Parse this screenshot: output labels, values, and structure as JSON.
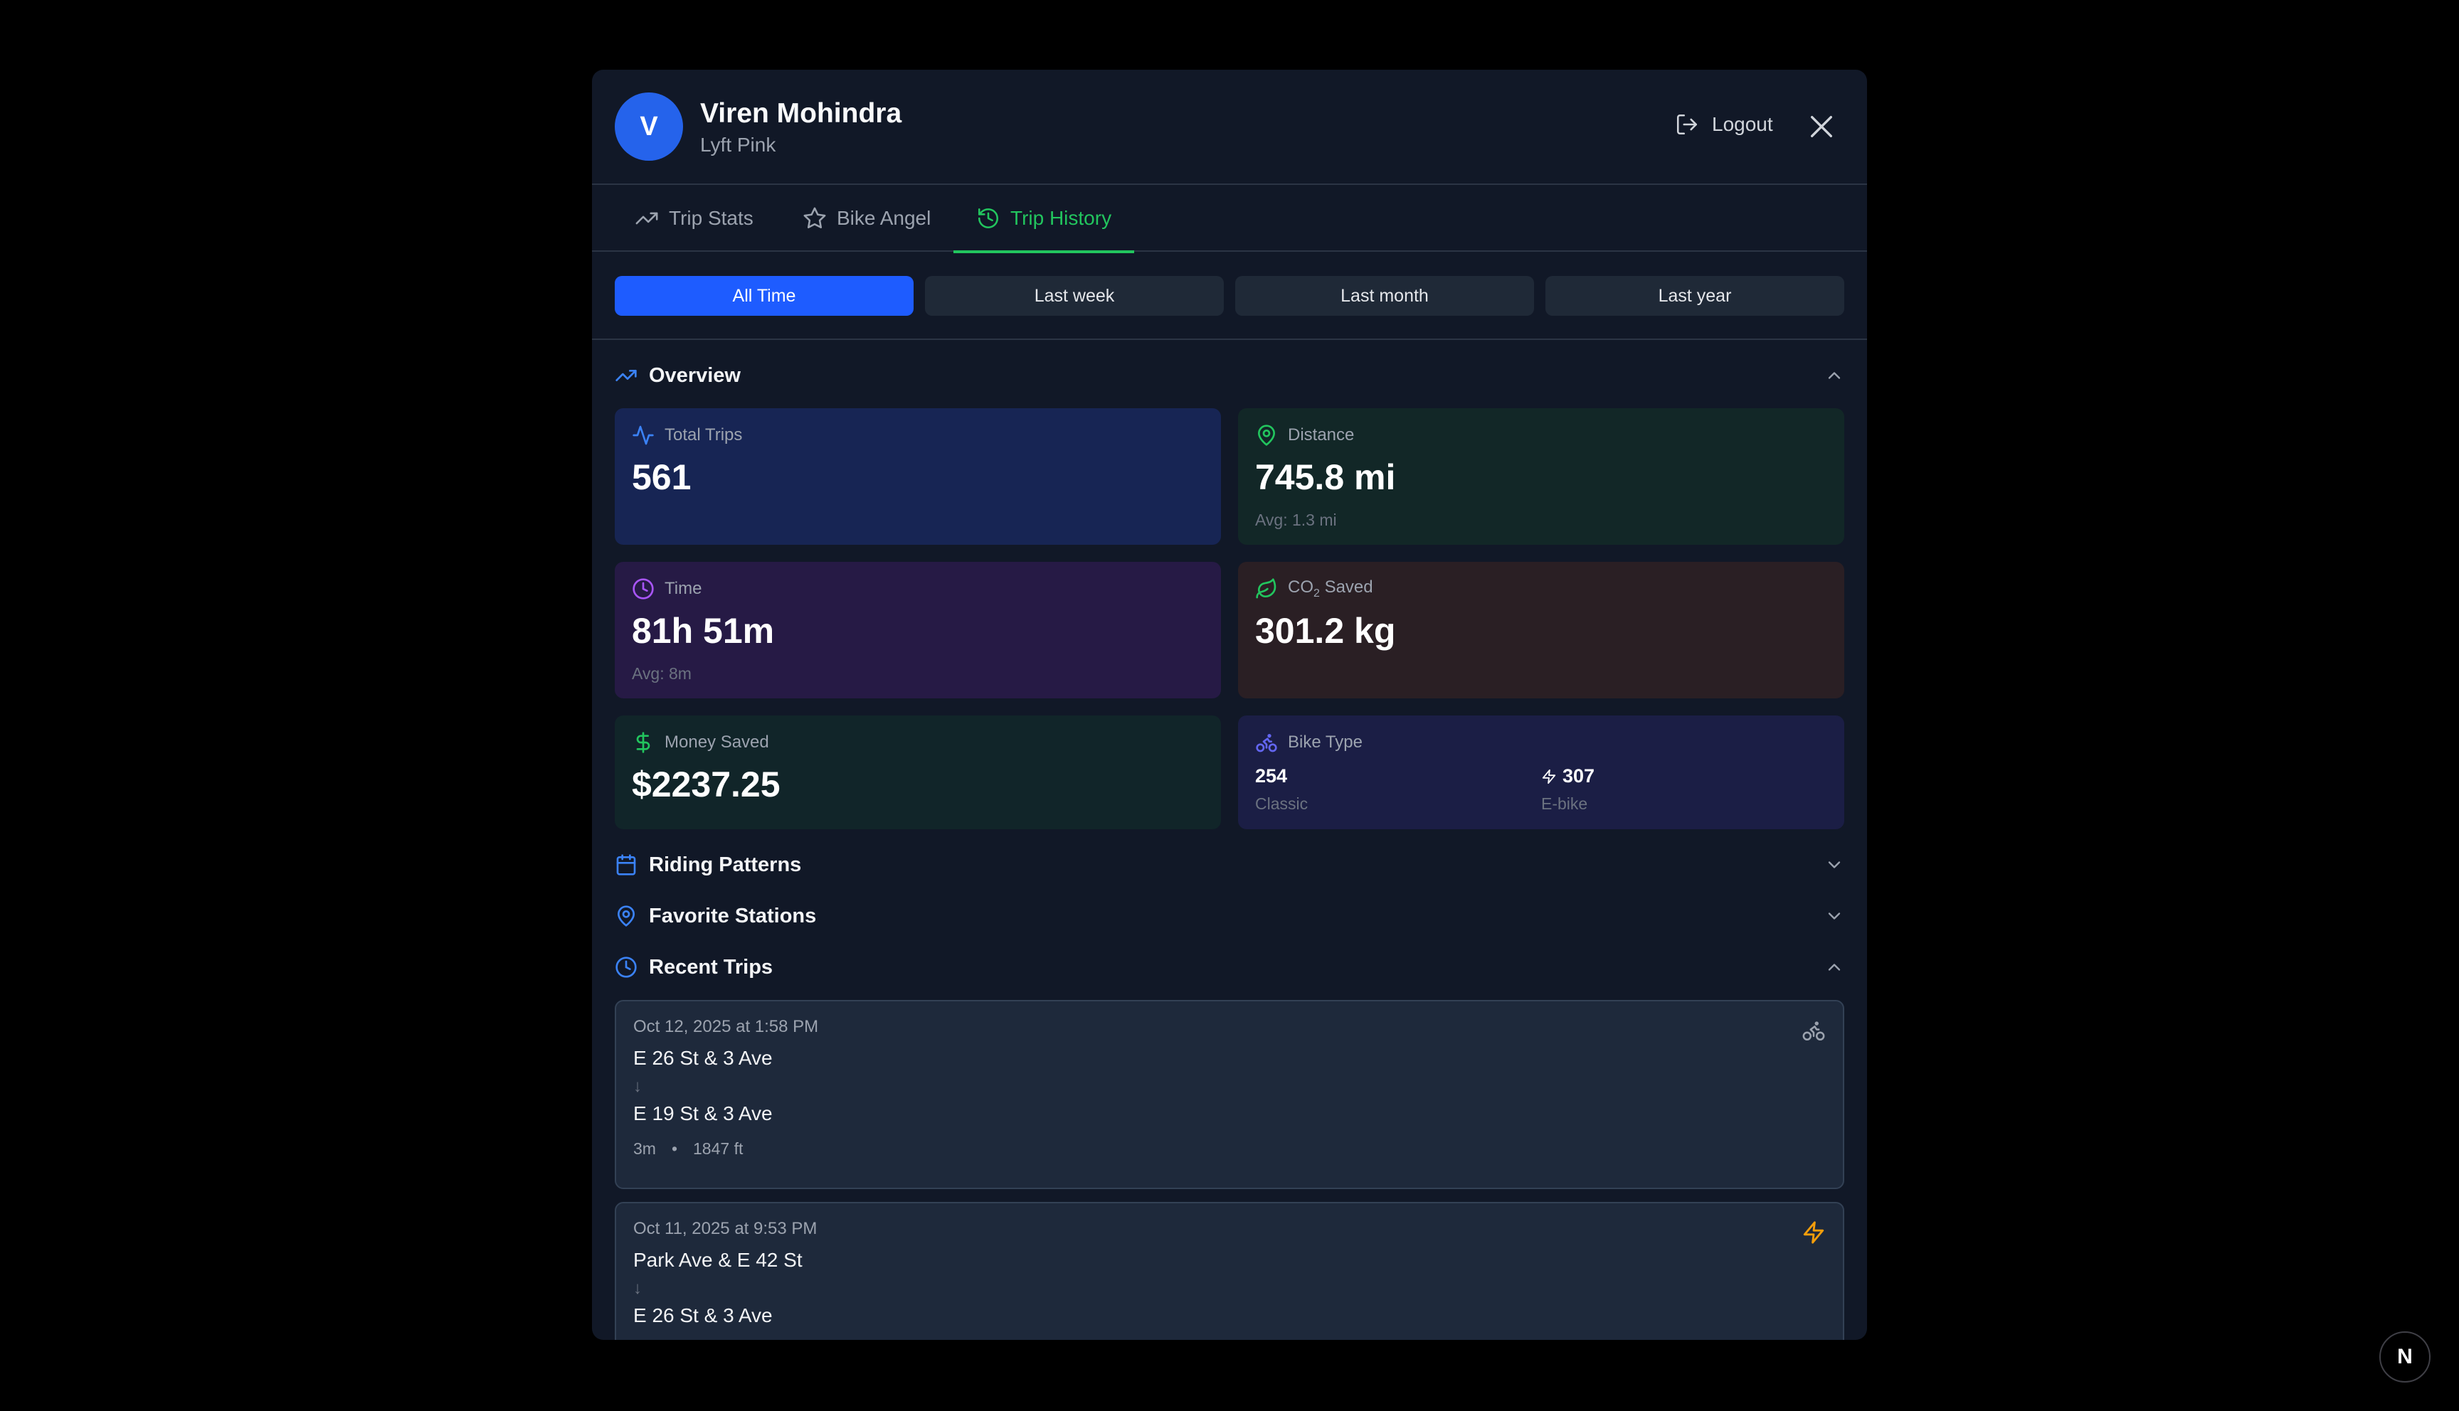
{
  "user": {
    "initial": "V",
    "name": "Viren Mohindra",
    "plan": "Lyft Pink"
  },
  "header": {
    "logout_label": "Logout"
  },
  "tabs": [
    {
      "label": "Trip Stats",
      "active": false
    },
    {
      "label": "Bike Angel",
      "active": false
    },
    {
      "label": "Trip History",
      "active": true
    }
  ],
  "filters": [
    {
      "label": "All Time",
      "active": true
    },
    {
      "label": "Last week",
      "active": false
    },
    {
      "label": "Last month",
      "active": false
    },
    {
      "label": "Last year",
      "active": false
    }
  ],
  "overview": {
    "title": "Overview",
    "expanded": true,
    "total_trips": {
      "label": "Total Trips",
      "value": "561"
    },
    "distance": {
      "label": "Distance",
      "value": "745.8 mi",
      "avg": "Avg: 1.3 mi"
    },
    "time": {
      "label": "Time",
      "value": "81h 51m",
      "avg": "Avg: 8m"
    },
    "co2": {
      "label_prefix": "CO",
      "label_sub": "2",
      "label_suffix": " Saved",
      "value": "301.2 kg"
    },
    "money": {
      "label": "Money Saved",
      "value": "$2237.25"
    },
    "bike_type": {
      "label": "Bike Type",
      "classic_count": "254",
      "classic_label": "Classic",
      "ebike_count": "307",
      "ebike_label": "E-bike"
    }
  },
  "sections": {
    "riding_patterns": {
      "title": "Riding Patterns",
      "expanded": false
    },
    "favorite_stations": {
      "title": "Favorite Stations",
      "expanded": false
    },
    "recent_trips": {
      "title": "Recent Trips",
      "expanded": true
    }
  },
  "recent_trips": [
    {
      "date": "Oct 12, 2025 at 1:58 PM",
      "from": "E 26 St & 3 Ave",
      "arrow": "↓",
      "to": "E 19 St & 3 Ave",
      "duration": "3m",
      "separator": "•",
      "distance": "1847 ft",
      "bike": "classic-bike-icon"
    },
    {
      "date": "Oct 11, 2025 at 9:53 PM",
      "from": "Park Ave & E 42 St",
      "arrow": "↓",
      "to": "E 26 St & 3 Ave",
      "bike": "ebike-bolt-icon"
    }
  ],
  "colors": {
    "background": "#000000",
    "modal": "#111827",
    "accent_blue": "#1e5cff",
    "accent_green": "#22c55e",
    "card_trips": "#172554",
    "card_distance": "#122727",
    "card_time": "#261a45",
    "card_co2": "#2a1f24",
    "card_money": "#112529",
    "card_bike": "#1b1e45",
    "ebike_bolt": "#f59e0b"
  },
  "floating_badge": {
    "letter": "N"
  }
}
